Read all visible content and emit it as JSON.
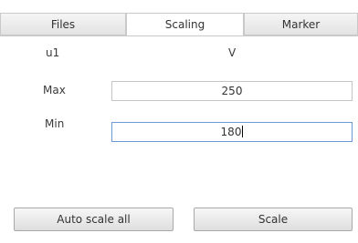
{
  "tabs": [
    {
      "label": "Files",
      "active": false
    },
    {
      "label": "Scaling",
      "active": true
    },
    {
      "label": "Marker",
      "active": false
    }
  ],
  "channel": {
    "name": "u1",
    "unit": "V"
  },
  "max": {
    "label": "Max",
    "value": "250"
  },
  "min": {
    "label": "Min",
    "value": "180"
  },
  "buttons": {
    "auto_scale_all": "Auto scale all",
    "scale": "Scale"
  }
}
